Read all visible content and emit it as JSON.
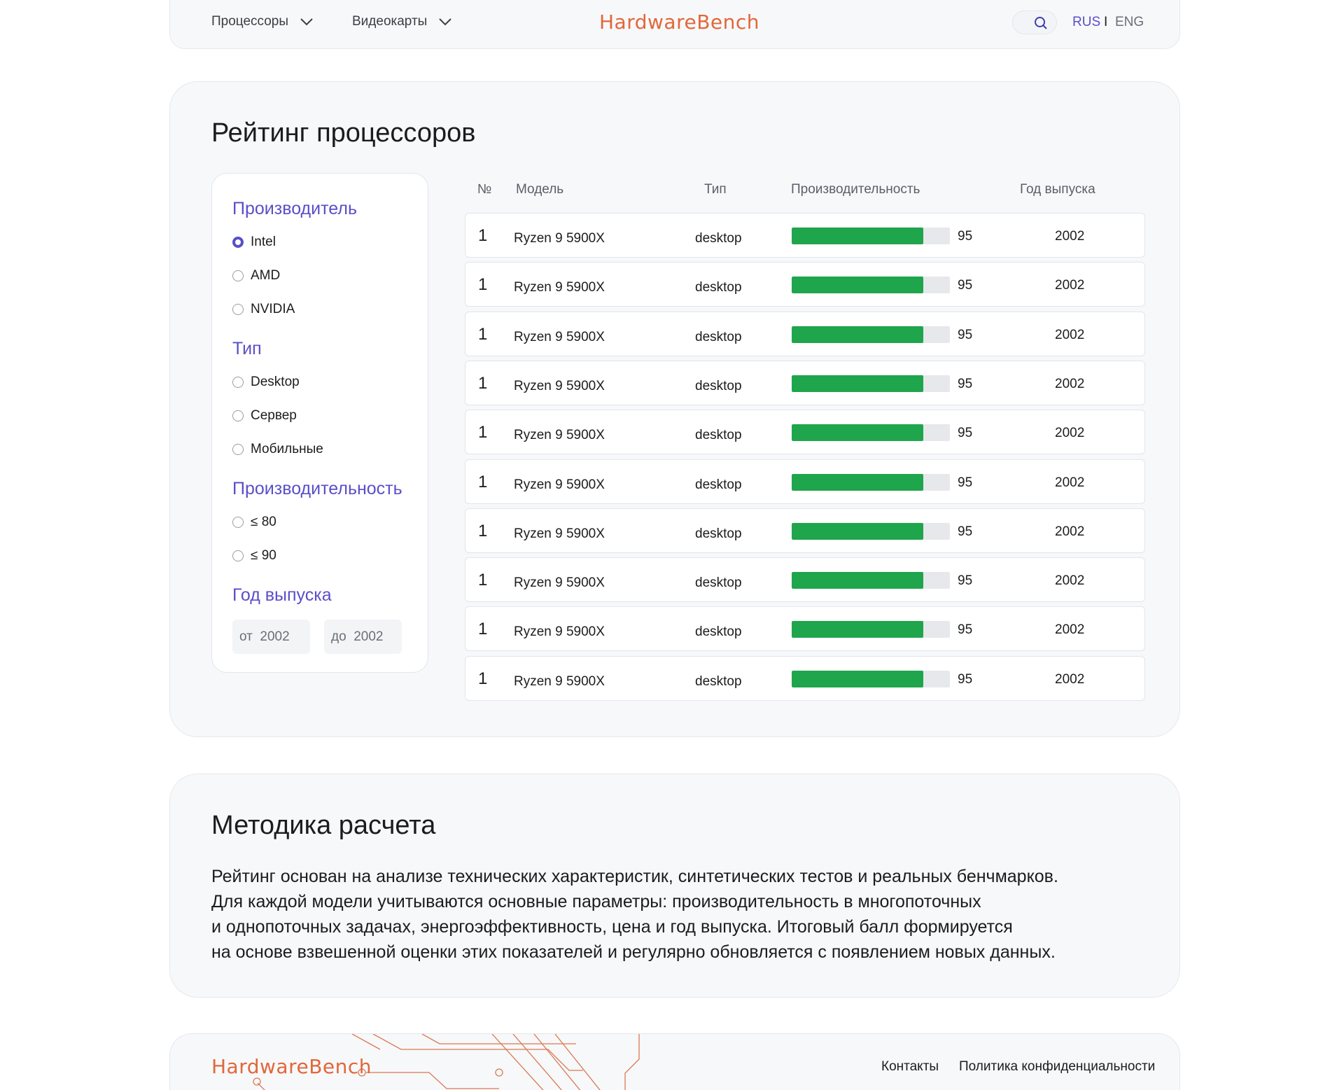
{
  "header": {
    "nav": [
      {
        "label": "Процессоры",
        "icon": "chevron-down-icon"
      },
      {
        "label": "Видеокарты",
        "icon": "chevron-down-icon"
      }
    ],
    "logo": "HardwareBench",
    "search_icon": "search-icon",
    "lang": {
      "rus": "RUS",
      "sep": "I",
      "eng": "ENG"
    }
  },
  "rating": {
    "title": "Рейтинг процессоров",
    "filters": {
      "manufacturer": {
        "title": "Производитель",
        "options": [
          "Intel",
          "AMD",
          "NVIDIA"
        ],
        "selected": "Intel"
      },
      "type": {
        "title": "Тип",
        "options": [
          "Desktop",
          "Сервер",
          "Мобильные"
        ]
      },
      "performance": {
        "title": "Производительность",
        "options": [
          "≤ 80",
          "≤ 90"
        ]
      },
      "year": {
        "title": "Год выпуска",
        "from_label": "от",
        "from_value": "2002",
        "to_label": "до",
        "to_value": "2002"
      }
    },
    "table": {
      "headers": [
        "№",
        "Модель",
        "Тип",
        "Производительность",
        "Год выпуска"
      ],
      "rows": [
        {
          "num": "1",
          "model": "Ryzen 9 5900X",
          "type": "desktop",
          "score": "95",
          "year": "2002"
        },
        {
          "num": "1",
          "model": "Ryzen 9 5900X",
          "type": "desktop",
          "score": "95",
          "year": "2002"
        },
        {
          "num": "1",
          "model": "Ryzen 9 5900X",
          "type": "desktop",
          "score": "95",
          "year": "2002"
        },
        {
          "num": "1",
          "model": "Ryzen 9 5900X",
          "type": "desktop",
          "score": "95",
          "year": "2002"
        },
        {
          "num": "1",
          "model": "Ryzen 9 5900X",
          "type": "desktop",
          "score": "95",
          "year": "2002"
        },
        {
          "num": "1",
          "model": "Ryzen 9 5900X",
          "type": "desktop",
          "score": "95",
          "year": "2002"
        },
        {
          "num": "1",
          "model": "Ryzen 9 5900X",
          "type": "desktop",
          "score": "95",
          "year": "2002"
        },
        {
          "num": "1",
          "model": "Ryzen 9 5900X",
          "type": "desktop",
          "score": "95",
          "year": "2002"
        },
        {
          "num": "1",
          "model": "Ryzen 9 5900X",
          "type": "desktop",
          "score": "95",
          "year": "2002"
        },
        {
          "num": "1",
          "model": "Ryzen 9 5900X",
          "type": "desktop",
          "score": "95",
          "year": "2002"
        }
      ],
      "bar_fill_fraction": 0.83,
      "bar_color": "#1fa54c"
    }
  },
  "method": {
    "title": "Методика расчета",
    "lines": [
      "Рейтинг основан на анализе технических характеристик, синтетических тестов и реальных бенчмарков.",
      "Для каждой модели учитываются основные параметры: производительность в многопоточных",
      "и однопоточных задачах, энергоэффективность, цена и год выпуска. Итоговый балл формируется",
      "на основе взвешенной оценки этих показателей и регулярно обновляется с появлением новых данных."
    ]
  },
  "footer": {
    "logo": "HardwareBench",
    "links": [
      "Контакты",
      "Политика конфиденциальности"
    ]
  },
  "colors": {
    "accent": "#5a4fc8",
    "brand": "#e2673a",
    "bar": "#1fa54c"
  }
}
